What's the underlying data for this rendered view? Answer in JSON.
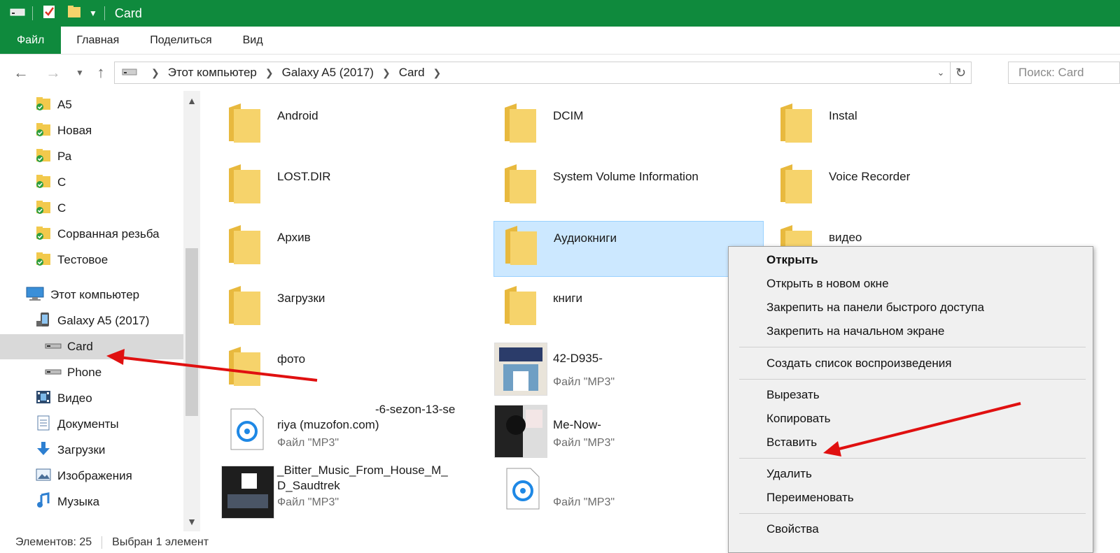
{
  "titlebar": {
    "title": "Card"
  },
  "ribbon": {
    "tabs": [
      "Файл",
      "Главная",
      "Поделиться",
      "Вид"
    ]
  },
  "address": {
    "crumbs": [
      "Этот компьютер",
      "Galaxy A5 (2017)",
      "Card"
    ]
  },
  "search": {
    "placeholder": "Поиск: Card"
  },
  "sidebar": {
    "items": [
      {
        "label": "A5",
        "icon": "folder-synced-icon"
      },
      {
        "label": "Новая",
        "icon": "folder-synced-icon"
      },
      {
        "label": "Ра",
        "icon": "folder-synced-icon"
      },
      {
        "label": "С",
        "icon": "folder-synced-icon"
      },
      {
        "label": "С",
        "icon": "folder-synced-icon"
      },
      {
        "label": "Сорванная резьба",
        "icon": "folder-synced-icon"
      },
      {
        "label": "Тестовое",
        "icon": "folder-synced-icon"
      },
      {
        "label": "Этот компьютер",
        "icon": "computer-icon"
      },
      {
        "label": "Galaxy A5 (2017)",
        "icon": "phone-icon"
      },
      {
        "label": "Card",
        "icon": "drive-icon"
      },
      {
        "label": "Phone",
        "icon": "drive-icon"
      },
      {
        "label": "Видео",
        "icon": "video-icon"
      },
      {
        "label": "Документы",
        "icon": "documents-icon"
      },
      {
        "label": "Загрузки",
        "icon": "downloads-icon"
      },
      {
        "label": "Изображения",
        "icon": "pictures-icon"
      },
      {
        "label": "Музыка",
        "icon": "music-icon"
      }
    ]
  },
  "files": {
    "items": [
      {
        "name": "Android",
        "type": "folder"
      },
      {
        "name": "DCIM",
        "type": "folder"
      },
      {
        "name": "Instal",
        "type": "folder"
      },
      {
        "name": "LOST.DIR",
        "type": "folder"
      },
      {
        "name": "System Volume Information",
        "type": "folder"
      },
      {
        "name": "Voice Recorder",
        "type": "folder"
      },
      {
        "name": "Архив",
        "type": "folder"
      },
      {
        "name": "Аудиокниги",
        "type": "folder"
      },
      {
        "name": "видео",
        "type": "folder"
      },
      {
        "name": "Загрузки",
        "type": "folder"
      },
      {
        "name": "книги",
        "type": "folder"
      },
      {
        "name": "фото",
        "type": "folder"
      },
      {
        "name_line1": "42-D935-",
        "name_line2": "",
        "ftype": "Файл \"MP3\""
      },
      {
        "name_line1": "-6-sezon-13-se",
        "name_line2": "riya (muzofon.com)",
        "ftype": "Файл \"MP3\""
      },
      {
        "name_line1": "Me-Now-",
        "name_line2": "",
        "ftype": "Файл \"MP3\""
      },
      {
        "name_line1": "_Bitter_Music_From_House_M_",
        "name_line2": "D_Saudtrek",
        "ftype": "Файл \"MP3\""
      },
      {
        "name_line1": "",
        "name_line2": "",
        "ftype": "Файл \"MP3\""
      }
    ]
  },
  "context_menu": {
    "items": [
      "Открыть",
      "Открыть в новом окне",
      "Закрепить на панели быстрого доступа",
      "Закрепить на начальном экране",
      "Создать список воспроизведения",
      "Вырезать",
      "Копировать",
      "Вставить",
      "Удалить",
      "Переименовать",
      "Свойства"
    ]
  },
  "status": {
    "count": "Элементов: 25",
    "selected": "Выбран 1 элемент"
  },
  "colors": {
    "accent": "#0f8a3d",
    "selection": "#cce8ff",
    "folder": "#f2c94c",
    "arrow": "#e01010"
  }
}
